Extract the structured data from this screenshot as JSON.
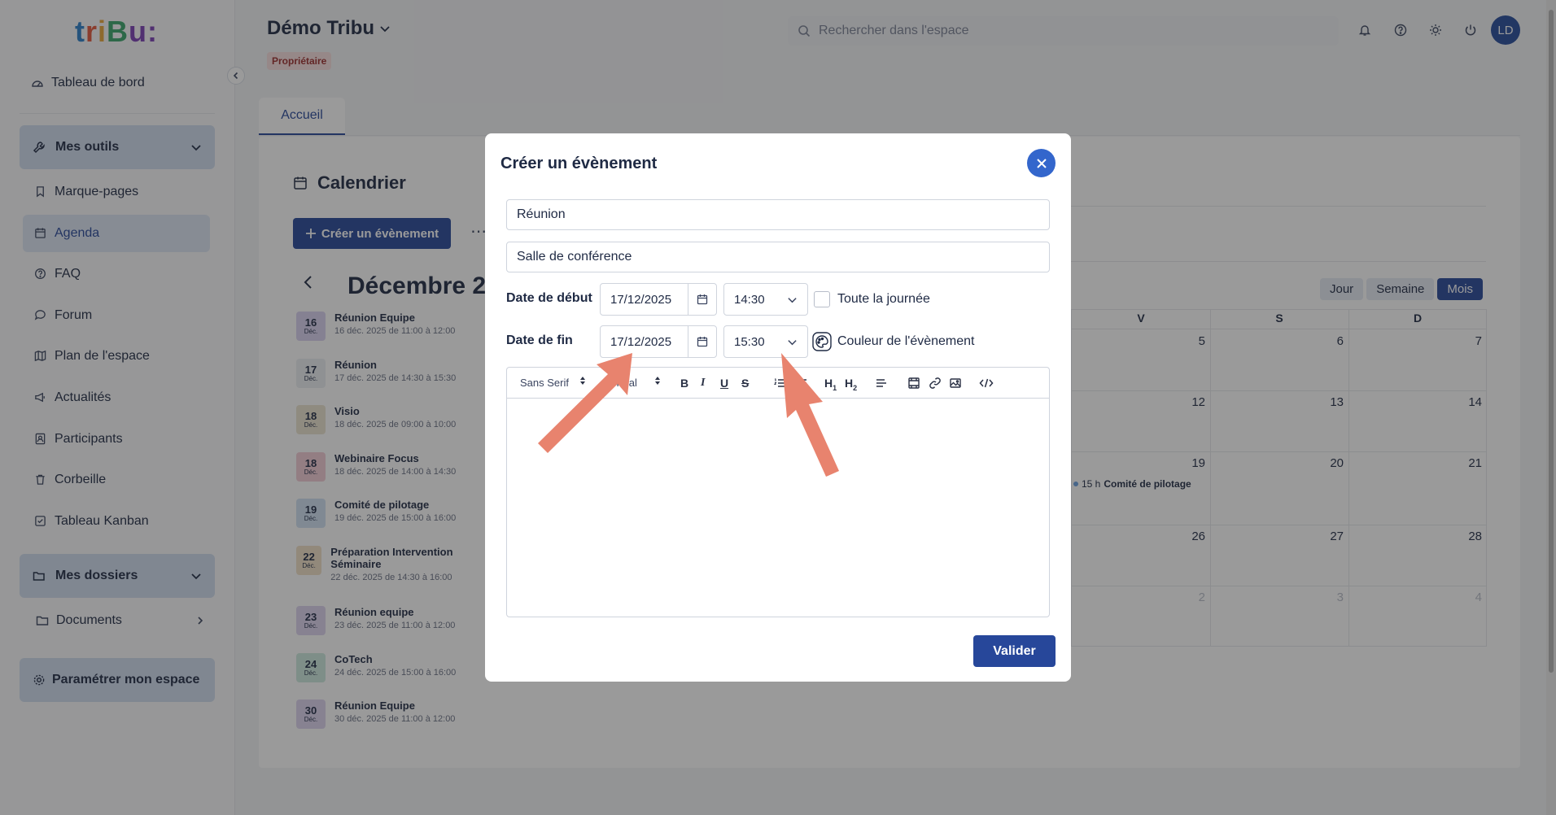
{
  "sidebar": {
    "logo": {
      "t1": "t",
      "t2": "r",
      "t3": "i",
      "t4": "B",
      "t5": "u",
      "colon": ":"
    },
    "dashboard": "Tableau de bord",
    "tools_header": "Mes outils",
    "tools": [
      {
        "label": "Marque-pages",
        "icon": "bookmark-icon"
      },
      {
        "label": "Agenda",
        "icon": "calendar-icon",
        "active": true
      },
      {
        "label": "FAQ",
        "icon": "help-circle-icon"
      },
      {
        "label": "Forum",
        "icon": "chat-icon"
      },
      {
        "label": "Plan de l'espace",
        "icon": "map-icon"
      },
      {
        "label": "Actualités",
        "icon": "megaphone-icon"
      },
      {
        "label": "Participants",
        "icon": "contacts-icon"
      },
      {
        "label": "Corbeille",
        "icon": "trash-icon"
      },
      {
        "label": "Tableau Kanban",
        "icon": "kanban-icon"
      }
    ],
    "folders_header": "Mes dossiers",
    "documents": "Documents",
    "settings": "Paramétrer mon espace"
  },
  "header": {
    "space_title": "Démo Tribu",
    "role_badge": "Propriétaire",
    "search_placeholder": "Rechercher dans l'espace",
    "avatar_initials": "LD"
  },
  "main": {
    "tab": "Accueil",
    "calendar_title": "Calendrier",
    "create_button": "Créer un évènement",
    "more": "⋯",
    "month_label": "Décembre 2",
    "views": [
      "Jour",
      "Semaine",
      "Mois"
    ],
    "active_view": "Mois",
    "day_headers": [
      "V",
      "S",
      "D"
    ],
    "grid_numbers": [
      [
        "5",
        "6",
        "7"
      ],
      [
        "12",
        "13",
        "14"
      ],
      [
        "19",
        "20",
        "21"
      ],
      [
        "26",
        "27",
        "28"
      ],
      [
        "2",
        "3",
        "4"
      ]
    ],
    "grid_event": {
      "time": "15 h",
      "title": "Comité de pilotage"
    },
    "events": [
      {
        "day": "16",
        "mon": "Déc.",
        "title": "Réunion Equipe",
        "sub": "16 déc. 2025 de 11:00 à 12:00",
        "color": "#d9d2f0"
      },
      {
        "day": "17",
        "mon": "Déc.",
        "title": "Réunion",
        "sub": "17 déc. 2025 de 14:30 à 15:30",
        "color": "#eceef2"
      },
      {
        "day": "18",
        "mon": "Déc.",
        "title": "Visio",
        "sub": "18 déc. 2025 de 09:00 à 10:00",
        "color": "#ece3cf"
      },
      {
        "day": "18",
        "mon": "Déc.",
        "title": "Webinaire Focus",
        "sub": "18 déc. 2025 de 14:00 à 14:30",
        "color": "#f3ccd6"
      },
      {
        "day": "19",
        "mon": "Déc.",
        "title": "Comité de pilotage",
        "sub": "19 déc. 2025 de 15:00 à 16:00",
        "color": "#cfe0f3"
      },
      {
        "day": "22",
        "mon": "Déc.",
        "title": "Préparation Intervention Séminaire",
        "sub": "22 déc. 2025 de 14:30 à 16:00",
        "color": "#f1e1c7"
      },
      {
        "day": "23",
        "mon": "Déc.",
        "title": "Réunion equipe",
        "sub": "23 déc. 2025 de 11:00 à 12:00",
        "color": "#ddd3ef"
      },
      {
        "day": "24",
        "mon": "Déc.",
        "title": "CoTech",
        "sub": "24 déc. 2025 de 15:00 à 16:00",
        "color": "#cdeadf"
      },
      {
        "day": "30",
        "mon": "Déc.",
        "title": "Réunion Equipe",
        "sub": "30 déc. 2025 de 11:00 à 12:00",
        "color": "#ddd3ef"
      }
    ]
  },
  "modal": {
    "title": "Créer un évènement",
    "title_value": "Réunion",
    "location_value": "Salle de conférence",
    "start_label": "Date de début",
    "start_date": "17/12/2025",
    "start_time": "14:30",
    "all_day_label": "Toute la journée",
    "end_label": "Date de fin",
    "end_date": "17/12/2025",
    "end_time": "15:30",
    "color_label": "Couleur de l'évènement",
    "font_select": "Sans Serif",
    "size_select": "Normal",
    "submit": "Valider"
  },
  "colors": {
    "primary": "#27479a",
    "close_button": "#3366cc",
    "arrow": "#e8836e"
  }
}
